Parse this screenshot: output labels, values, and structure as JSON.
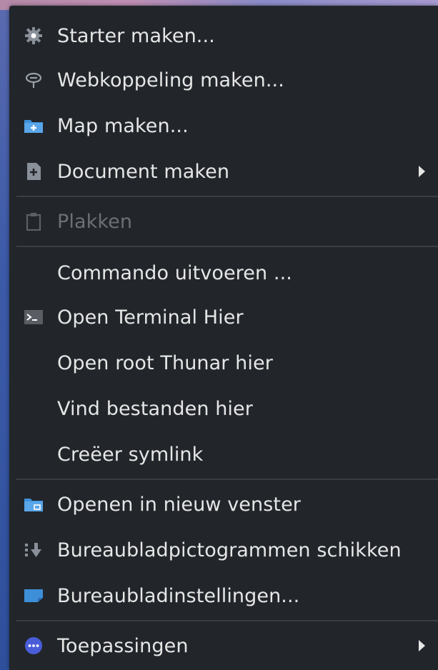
{
  "menu": {
    "items": [
      {
        "label": "Starter maken...",
        "icon": "gear-icon"
      },
      {
        "label": "Webkoppeling maken...",
        "icon": "link-icon"
      },
      {
        "label": "Map maken...",
        "icon": "folder-new-icon"
      },
      {
        "label": "Document maken",
        "icon": "document-new-icon",
        "submenu": true
      },
      {
        "label": "Plakken",
        "icon": "clipboard-icon",
        "disabled": true
      },
      {
        "label": "Commando uitvoeren ..."
      },
      {
        "label": "Open Terminal Hier",
        "icon": "terminal-icon"
      },
      {
        "label": "Open root Thunar hier"
      },
      {
        "label": "Vind bestanden hier"
      },
      {
        "label": "Creëer symlink"
      },
      {
        "label": "Openen in nieuw venster",
        "icon": "folder-open-icon"
      },
      {
        "label": "Bureaubladpictogrammen schikken",
        "icon": "arrange-icon"
      },
      {
        "label": "Bureaubladinstellingen...",
        "icon": "desktop-settings-icon"
      },
      {
        "label": "Toepassingen",
        "icon": "applications-icon",
        "submenu": true
      }
    ]
  },
  "colors": {
    "menu_bg": "#22262b",
    "text": "#e6e6e6",
    "text_disabled": "#6c7075",
    "accent_blue": "#3d8fd8"
  }
}
